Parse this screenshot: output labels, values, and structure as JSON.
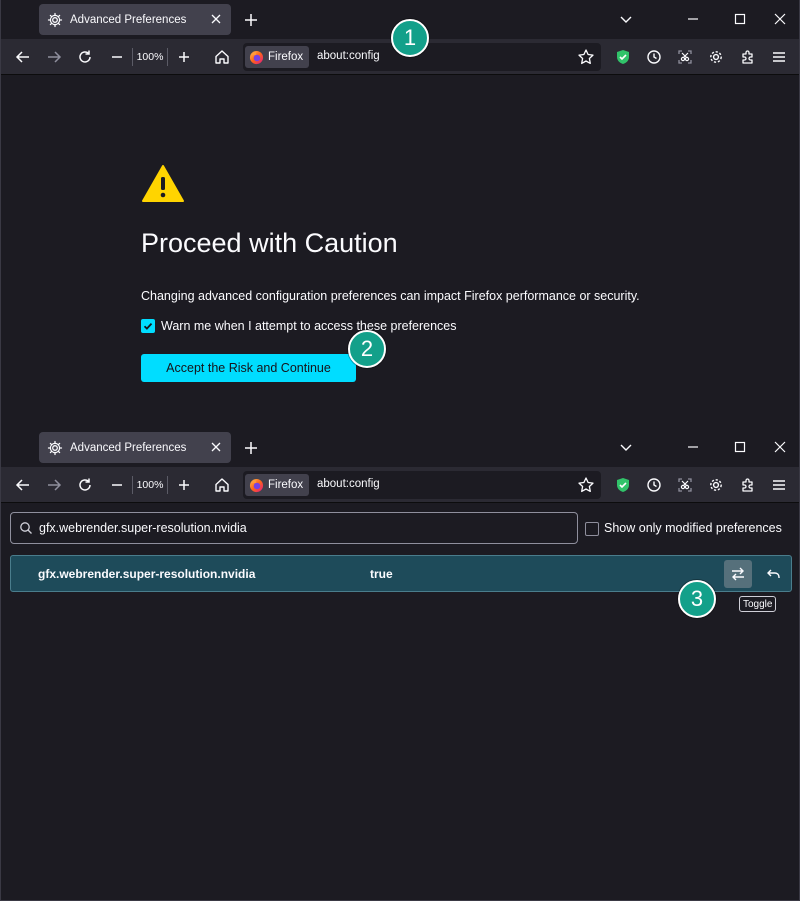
{
  "browser": {
    "tab_title": "Advanced Preferences",
    "identity_label": "Firefox",
    "url": "about:config",
    "zoom": "100%"
  },
  "caution": {
    "title": "Proceed with Caution",
    "description": "Changing advanced configuration preferences can impact Firefox performance or security.",
    "warn_label": "Warn me when I attempt to access these preferences",
    "warn_checked": true,
    "accept_button": "Accept the Risk and Continue"
  },
  "config": {
    "search_value": "gfx.webrender.super-resolution.nvidia",
    "show_modified_label": "Show only modified preferences",
    "show_modified_checked": false,
    "pref": {
      "name": "gfx.webrender.super-resolution.nvidia",
      "value": "true"
    },
    "tooltip": "Toggle"
  },
  "badges": [
    "1",
    "2",
    "3"
  ],
  "colors": {
    "accent": "#00ddff",
    "badge": "#13a08a",
    "row_highlight": "#1e4b5a",
    "warning": "#ffd400"
  }
}
